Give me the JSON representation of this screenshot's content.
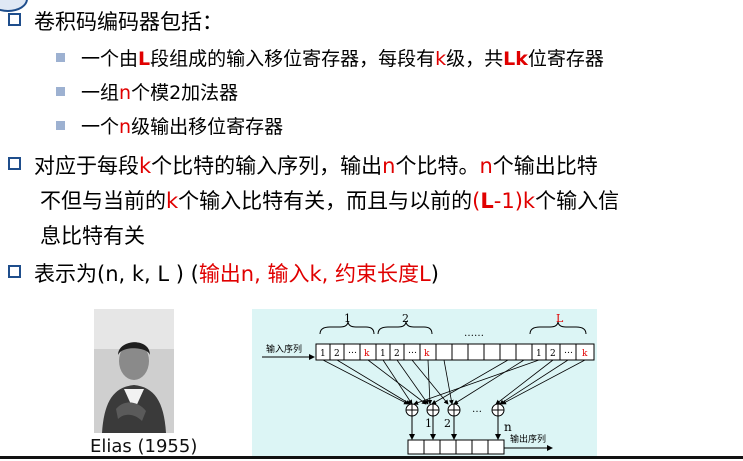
{
  "slide": {
    "b1": {
      "text": "卷积码编码器包括："
    },
    "b1_1": {
      "pre": "一个由",
      "L": "L",
      "mid": "段组成的输入移位寄存器，每段有",
      "k": "k",
      "mid2": "级，共",
      "Lk": "Lk",
      "post": "位寄存器"
    },
    "b1_2": {
      "pre": "一组",
      "n": "n",
      "post": "个模2加法器"
    },
    "b1_3": {
      "pre": "一个",
      "n": "n",
      "post": "级输出移位寄存器"
    },
    "b2": {
      "p1": "对应于每段",
      "k": "k",
      "p2": "个比特的输入序列，输出",
      "n": "n",
      "p3": "个比特。",
      "n2": "n",
      "p4": "个输出比特",
      "l2_p1": "不但与当前的",
      "l2_k": "k",
      "l2_p2": "个输入比特有关，而且与以前的",
      "l2_paren": "(",
      "l2_L": "L",
      "l2_minus": "-1)",
      "l2_k2": "k",
      "l2_p3": "个输入信",
      "l3": "息比特有关"
    },
    "b3": {
      "pre": "表示为(n, k, L ) (",
      "red": "输出n, 输入k, 约束长度L",
      "post": ")"
    }
  },
  "photo": {
    "caption": "Elias (1955)"
  },
  "diagram": {
    "input_label": "输入序列",
    "output_label": "输出序列",
    "seg_label_1": "1",
    "seg_label_2": "2",
    "seg_label_dots": "……",
    "seg_label_L": "L",
    "cell_1": "1",
    "cell_2": "2",
    "cell_dots": "…",
    "cell_k": "k",
    "adder_dots": "…",
    "adder_1": "1",
    "adder_2": "2",
    "adder_n": "n"
  }
}
